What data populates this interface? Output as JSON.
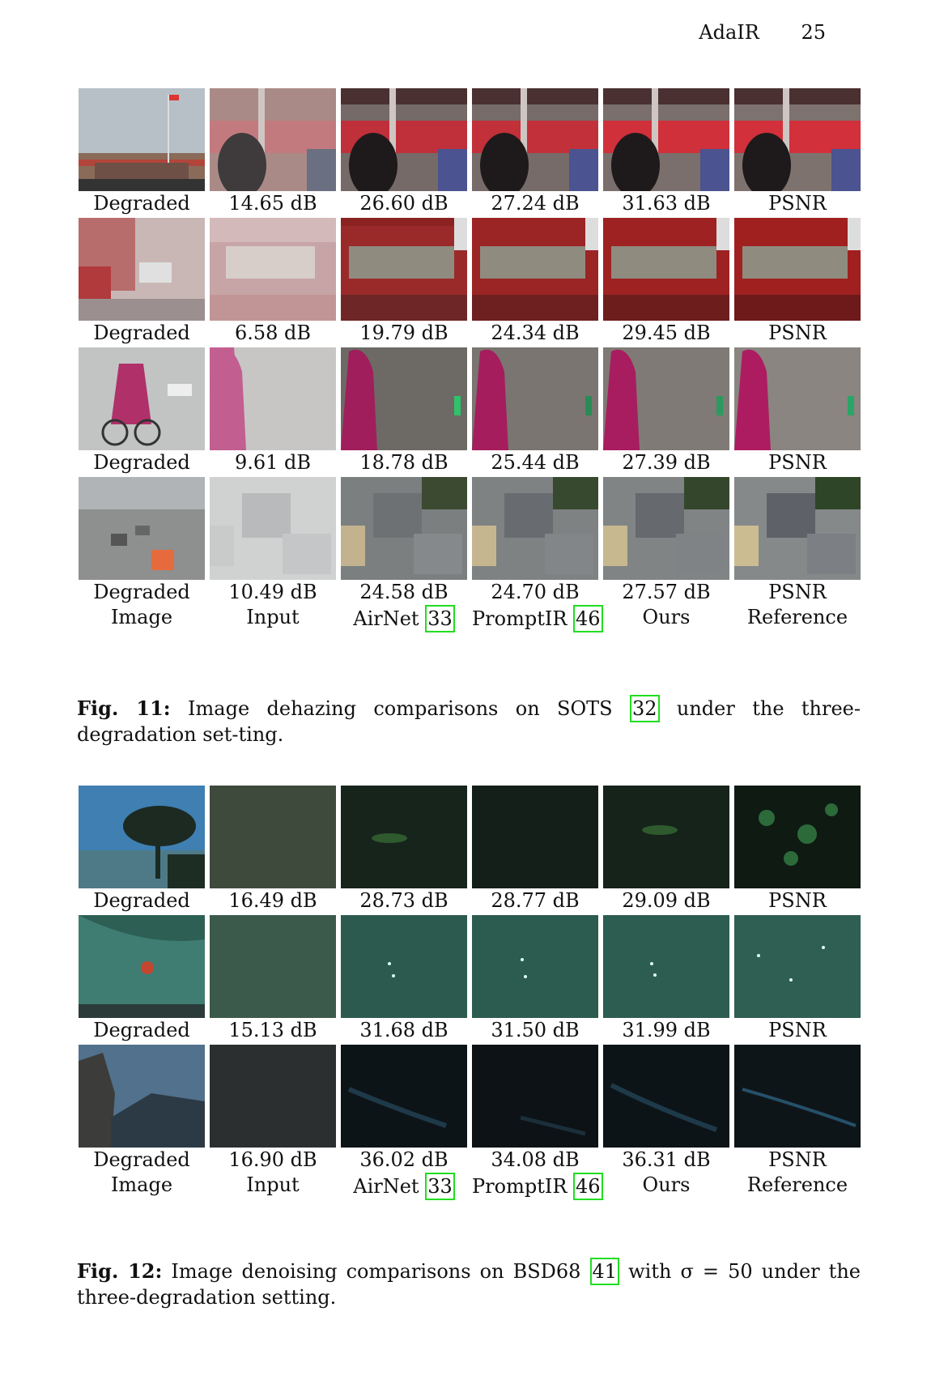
{
  "header": {
    "title": "AdaIR",
    "page_number": "25"
  },
  "fig11": {
    "rows": [
      {
        "labels": [
          "Degraded",
          "14.65 dB",
          "26.60 dB",
          "27.24 dB",
          "31.63 dB",
          "PSNR"
        ]
      },
      {
        "labels": [
          "Degraded",
          "6.58 dB",
          "19.79 dB",
          "24.34 dB",
          "29.45 dB",
          "PSNR"
        ]
      },
      {
        "labels": [
          "Degraded",
          "9.61 dB",
          "18.78 dB",
          "25.44 dB",
          "27.39 dB",
          "PSNR"
        ]
      },
      {
        "labels": [
          "Degraded",
          "10.49 dB",
          "24.58 dB",
          "24.70 dB",
          "27.57 dB",
          "PSNR"
        ]
      }
    ],
    "bottom_labels": [
      "Image",
      "Input",
      "AirNet",
      "PromptIR",
      "Ours",
      "Reference"
    ],
    "ref_airnet": "33",
    "ref_promptir": "46",
    "caption_label": "Fig. 11:",
    "caption_text_1": "Image dehazing comparisons on SOTS",
    "caption_ref": "32",
    "caption_text_2": "under the three-degradation set-ting."
  },
  "fig12": {
    "rows": [
      {
        "labels": [
          "Degraded",
          "16.49 dB",
          "28.73 dB",
          "28.77 dB",
          "29.09 dB",
          "PSNR"
        ]
      },
      {
        "labels": [
          "Degraded",
          "15.13 dB",
          "31.68 dB",
          "31.50 dB",
          "31.99 dB",
          "PSNR"
        ]
      },
      {
        "labels": [
          "Degraded",
          "16.90 dB",
          "36.02 dB",
          "34.08 dB",
          "36.31 dB",
          "PSNR"
        ]
      }
    ],
    "bottom_labels": [
      "Image",
      "Input",
      "AirNet",
      "PromptIR",
      "Ours",
      "Reference"
    ],
    "ref_airnet": "33",
    "ref_promptir": "46",
    "caption_label": "Fig. 12:",
    "caption_text_1": "Image denoising comparisons on BSD68",
    "caption_ref": "41",
    "caption_text_2": "with σ = 50 under the three-degradation setting."
  },
  "colors": {
    "ref_box": "#22dd22"
  }
}
